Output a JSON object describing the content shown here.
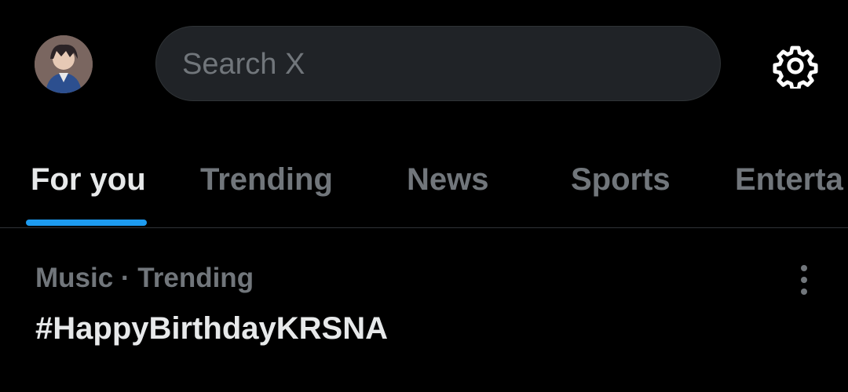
{
  "header": {
    "avatar_icon": "user-avatar",
    "search": {
      "placeholder": "Search X",
      "icon": "none"
    },
    "settings_icon": "gear-icon"
  },
  "tabs": [
    {
      "label": "For you",
      "active": true
    },
    {
      "label": "Trending",
      "active": false
    },
    {
      "label": "News",
      "active": false
    },
    {
      "label": "Sports",
      "active": false
    },
    {
      "label": "Enterta",
      "active": false
    }
  ],
  "trend": {
    "context": "Music · Trending",
    "title": "#HappyBirthdayKRSNA",
    "more_icon": "vertical-ellipsis-icon"
  },
  "colors": {
    "background": "#000000",
    "accent": "#1d9bf0",
    "text_primary": "#e7e9ea",
    "text_secondary": "#71767b",
    "search_bg": "#202327"
  }
}
